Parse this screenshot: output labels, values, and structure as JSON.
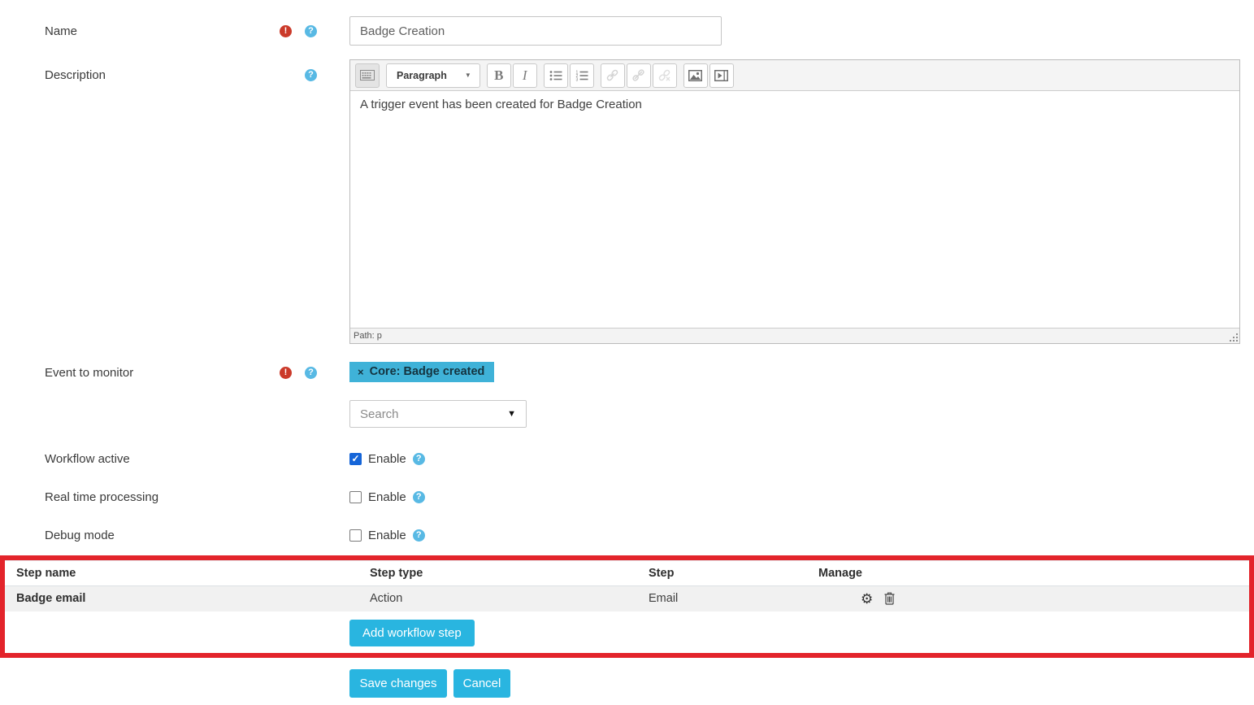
{
  "icons": {
    "required_glyph": "!",
    "help_glyph": "?"
  },
  "form": {
    "name": {
      "label": "Name",
      "value": "Badge Creation"
    },
    "description": {
      "label": "Description",
      "editor": {
        "paragraph_format": "Paragraph",
        "bold_label": "B",
        "italic_label": "I",
        "content": "A trigger event has been created for Badge Creation",
        "path_status": "Path: p"
      }
    },
    "event": {
      "label": "Event to monitor",
      "selected_tag": {
        "remove": "×",
        "label": "Core: Badge created"
      },
      "search_placeholder": "Search"
    },
    "toggles": [
      {
        "label": "Workflow active",
        "checkbox_label": "Enable",
        "checked": true
      },
      {
        "label": "Real time processing",
        "checkbox_label": "Enable",
        "checked": false
      },
      {
        "label": "Debug mode",
        "checkbox_label": "Enable",
        "checked": false
      }
    ],
    "steps": {
      "columns": [
        "Step name",
        "Step type",
        "Step",
        "Manage"
      ],
      "rows": [
        {
          "name": "Badge email",
          "type": "Action",
          "step": "Email"
        }
      ],
      "add_button": "Add workflow step"
    },
    "actions": {
      "save": "Save changes",
      "cancel": "Cancel"
    }
  },
  "colors": {
    "accent_button": "#29b5e0",
    "tag_background": "#3fb2d8",
    "highlight_border": "#e3242b",
    "checkbox_checked": "#1565d8",
    "help_icon": "#58b9e4",
    "required_icon": "#cb3a2a",
    "row_background": "#f1f1f1"
  }
}
